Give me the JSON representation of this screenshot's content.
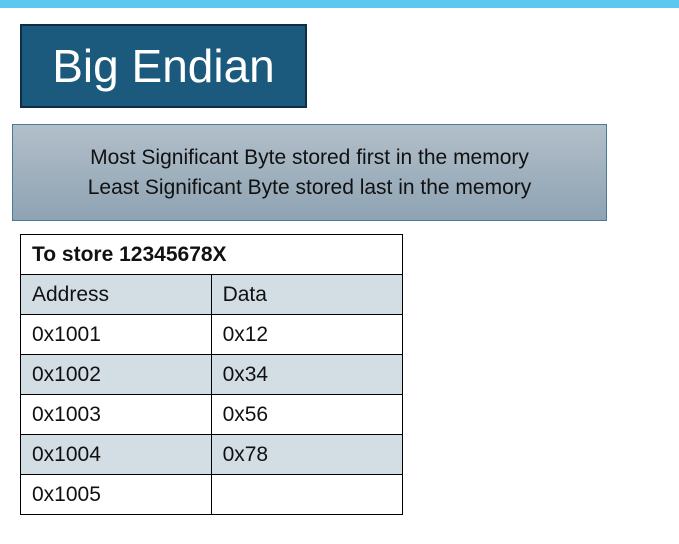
{
  "title": "Big Endian",
  "description": {
    "line1": "Most Significant Byte stored first in the memory",
    "line2": "Least Significant Byte stored last in the memory"
  },
  "table": {
    "caption": "To store 12345678X",
    "headers": {
      "address": "Address",
      "data": "Data"
    },
    "rows": [
      {
        "address": "0x1001",
        "data": "0x12"
      },
      {
        "address": "0x1002",
        "data": "0x34"
      },
      {
        "address": "0x1003",
        "data": "0x56"
      },
      {
        "address": "0x1004",
        "data": "0x78"
      },
      {
        "address": "0x1005",
        "data": ""
      }
    ]
  },
  "colors": {
    "top_bar": "#5cc8ee",
    "title_bg": "#1b5a7d",
    "desc_bg": "#9fb1bf",
    "row_shade": "#d3dde4"
  }
}
